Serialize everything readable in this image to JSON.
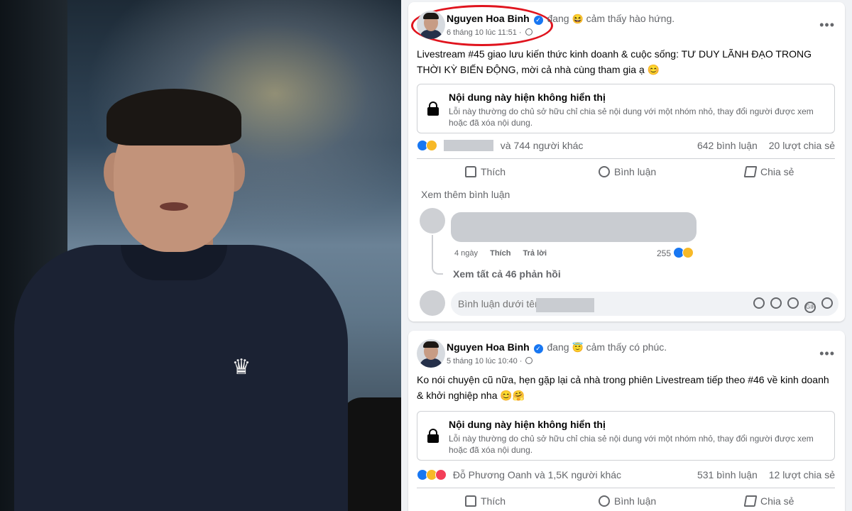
{
  "posts": [
    {
      "author": "Nguyen Hoa Binh",
      "feeling_prefix": "đang",
      "feeling_emoji": "😆",
      "feeling": "cảm thấy hào hứng.",
      "time": "6 tháng 10 lúc 11:51 ·",
      "text": "Livestream #45 giao lưu kiến thức kinh doanh & cuộc sống: TƯ DUY LÃNH ĐẠO TRONG THỜI KỲ BIẾN ĐỘNG, mời cả nhà cùng tham gia ạ 😊",
      "unavailable_title": "Nội dung này hiện không hiển thị",
      "unavailable_desc": "Lỗi này thường do chủ sở hữu chỉ chia sẻ nội dung với một nhóm nhỏ, thay đổi người được xem hoặc đã xóa nội dung.",
      "reactions_text": "và 744 người khác",
      "comments": "642 bình luận",
      "shares": "20 lượt chia sẻ",
      "like": "Thích",
      "comment": "Bình luận",
      "share": "Chia sẻ",
      "more_comments": "Xem thêm bình luận",
      "comment_age": "4 ngày",
      "comment_like": "Thích",
      "comment_reply": "Trả lời",
      "comment_reactions": "255",
      "view_replies": "Xem tất cả 46 phản hồi",
      "comment_placeholder": "Bình luận dưới tên"
    },
    {
      "author": "Nguyen Hoa Binh",
      "feeling_prefix": "đang",
      "feeling_emoji": "😇",
      "feeling": "cảm thấy có phúc.",
      "time": "5 tháng 10 lúc 10:40 ·",
      "text": "Ko nói chuyện cũ nữa, hẹn gặp lại cả nhà trong phiên Livestream tiếp theo #46 về kinh doanh & khởi nghiệp nha 😊🤗",
      "unavailable_title": "Nội dung này hiện không hiển thị",
      "unavailable_desc": "Lỗi này thường do chủ sở hữu chỉ chia sẻ nội dung với một nhóm nhỏ, thay đổi người được xem hoặc đã xóa nội dung.",
      "reactions_text": "Đỗ Phương Oanh và 1,5K người khác",
      "comments": "531 bình luận",
      "shares": "12 lượt chia sẻ",
      "like": "Thích",
      "comment": "Bình luận",
      "share": "Chia sẻ"
    }
  ],
  "colors": {
    "facebook_blue": "#1877f2",
    "highlight_red": "#e0141e",
    "muted_text": "#65676b"
  }
}
